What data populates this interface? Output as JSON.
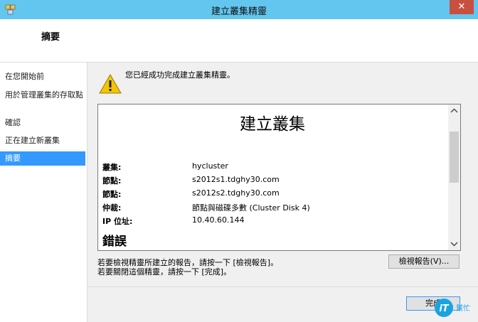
{
  "window": {
    "title": "建立叢集精靈",
    "close_glyph": "✕"
  },
  "header": {
    "title": "摘要"
  },
  "sidebar": {
    "items": [
      {
        "label": "在您開始前"
      },
      {
        "label": "用於管理叢集的存取點"
      },
      {
        "label": "確認"
      },
      {
        "label": "正在建立新叢集"
      },
      {
        "label": "摘要",
        "selected": true
      }
    ]
  },
  "content": {
    "success_message": "您已經成功完成建立叢集精靈。",
    "report": {
      "heading": "建立叢集",
      "rows": [
        {
          "label": "叢集:",
          "value": "hycluster"
        },
        {
          "label": "節點:",
          "value": "s2012s1.tdghy30.com"
        },
        {
          "label": "節點:",
          "value": "s2012s2.tdghy30.com"
        },
        {
          "label": "仲裁:",
          "value": "節點與磁碟多數 (Cluster Disk 4)"
        },
        {
          "label": "IP 位址:",
          "value": "10.40.60.144"
        }
      ],
      "error_heading": "錯誤"
    },
    "hint_view": "若要檢視精靈所建立的報告，請按一下 [檢視報告]。",
    "hint_finish": "若要關閉這個精靈，請按一下 [完成]。",
    "view_report_label": "檢視報告(V)...",
    "finish_label": "完成"
  },
  "icons": {
    "title": "cluster-wizard-icon",
    "status": "warning-icon",
    "scroll_up": "chevron-up-icon",
    "scroll_down": "chevron-down-icon"
  },
  "watermark": {
    "main": "iT",
    "sub": "幫忙"
  },
  "colors": {
    "titlebar": "#63c6ef",
    "close": "#c7503f",
    "selection": "#3399ff",
    "warning": "#f2c500"
  }
}
